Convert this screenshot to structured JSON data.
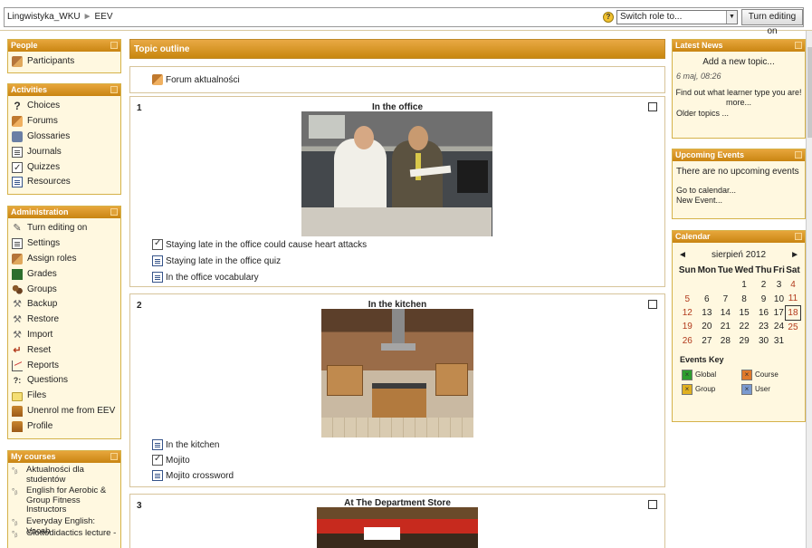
{
  "navbar": {
    "breadcrumb": [
      "Lingwistyka_WKU",
      "EEV"
    ],
    "breadcrumb_separator": "►",
    "help_icon": "?",
    "role_select_value": "Switch role to...",
    "turn_editing_button": "Turn editing on"
  },
  "blocks": {
    "people": {
      "title": "People",
      "items": [
        {
          "label": "Participants",
          "icon": "people-icon"
        }
      ]
    },
    "activities": {
      "title": "Activities",
      "items": [
        {
          "label": "Choices",
          "icon": "question-icon"
        },
        {
          "label": "Forums",
          "icon": "forum-icon"
        },
        {
          "label": "Glossaries",
          "icon": "glossary-icon"
        },
        {
          "label": "Journals",
          "icon": "journal-icon"
        },
        {
          "label": "Quizzes",
          "icon": "quiz-icon"
        },
        {
          "label": "Resources",
          "icon": "resource-icon"
        }
      ]
    },
    "administration": {
      "title": "Administration",
      "items": [
        {
          "label": "Turn editing on",
          "icon": "pencil-icon"
        },
        {
          "label": "Settings",
          "icon": "settings-icon"
        },
        {
          "label": "Assign roles",
          "icon": "roles-icon"
        },
        {
          "label": "Grades",
          "icon": "grades-icon"
        },
        {
          "label": "Groups",
          "icon": "groups-icon"
        },
        {
          "label": "Backup",
          "icon": "backup-icon"
        },
        {
          "label": "Restore",
          "icon": "restore-icon"
        },
        {
          "label": "Import",
          "icon": "import-icon"
        },
        {
          "label": "Reset",
          "icon": "reset-icon"
        },
        {
          "label": "Reports",
          "icon": "reports-icon"
        },
        {
          "label": "Questions",
          "icon": "questions-icon"
        },
        {
          "label": "Files",
          "icon": "folder-icon"
        },
        {
          "label": "Unenrol me from EEV",
          "icon": "unenrol-icon"
        },
        {
          "label": "Profile",
          "icon": "profile-icon"
        }
      ]
    },
    "my_courses": {
      "title": "My courses",
      "items": [
        {
          "label": "Aktualności dla studentów"
        },
        {
          "label": "English for Aerobic & Group Fitness Instructors"
        },
        {
          "label": "Everyday English: Vocab"
        },
        {
          "label": "Glottodidactics lecture -"
        }
      ]
    }
  },
  "topic_outline": {
    "header": "Topic outline",
    "section0": {
      "activity": "Forum aktualności"
    },
    "sections": [
      {
        "number": "1",
        "title": "In the office",
        "activities": [
          "Staying late in the office could cause heart attacks",
          "Staying late in the office quiz",
          "In the office vocabulary"
        ]
      },
      {
        "number": "2",
        "title": "In the kitchen",
        "activities": [
          "In the kitchen",
          "Mojito",
          "Mojito crossword"
        ]
      },
      {
        "number": "3",
        "title": "At The Department Store",
        "activities": []
      }
    ]
  },
  "latest_news": {
    "title": "Latest News",
    "add_topic": "Add a new topic...",
    "date": "6 maj, 08:26",
    "item": "Find out what learner type you are!",
    "more": "more...",
    "older": "Older topics ..."
  },
  "upcoming_events": {
    "title": "Upcoming Events",
    "text": "There are no upcoming events",
    "go_to_calendar": "Go to calendar...",
    "new_event": "New Event..."
  },
  "calendar": {
    "title": "Calendar",
    "month": "sierpień 2012",
    "prev": "◄",
    "next": "►",
    "days": [
      "Sun",
      "Mon",
      "Tue",
      "Wed",
      "Thu",
      "Fri",
      "Sat"
    ],
    "weeks": [
      [
        "",
        "",
        "",
        "1",
        "2",
        "3",
        "4"
      ],
      [
        "5",
        "6",
        "7",
        "8",
        "9",
        "10",
        "11"
      ],
      [
        "12",
        "13",
        "14",
        "15",
        "16",
        "17",
        "18"
      ],
      [
        "19",
        "20",
        "21",
        "22",
        "23",
        "24",
        "25"
      ],
      [
        "26",
        "27",
        "28",
        "29",
        "30",
        "31",
        ""
      ]
    ],
    "today": "18",
    "events_key_title": "Events Key",
    "events_key": [
      {
        "label": "Global",
        "color": "#2e9e2e"
      },
      {
        "label": "Course",
        "color": "#e07a2a"
      },
      {
        "label": "Group",
        "color": "#e0b020"
      },
      {
        "label": "User",
        "color": "#7a9ad0"
      }
    ]
  },
  "colors": {
    "header_orange": "#d18c1e",
    "block_bg": "#fff8e0",
    "weekend_red": "#b23b1d"
  }
}
